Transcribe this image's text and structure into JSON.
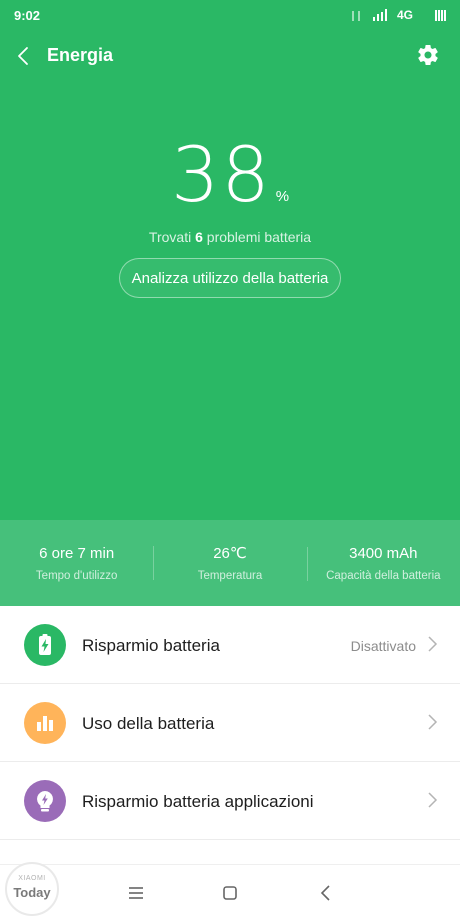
{
  "status": {
    "time": "9:02",
    "network": "4G"
  },
  "header": {
    "title": "Energia"
  },
  "battery": {
    "level": "38",
    "unit": "%"
  },
  "problems": {
    "prefix": "Trovati",
    "count": "6",
    "suffix": "problemi batteria"
  },
  "analyze_button": "Analizza utilizzo della batteria",
  "stats": [
    {
      "value": "6 ore 7 min",
      "label": "Tempo d'utilizzo"
    },
    {
      "value": "26℃",
      "label": "Temperatura"
    },
    {
      "value": "3400 mAh",
      "label": "Capacità della batteria"
    }
  ],
  "list": [
    {
      "label": "Risparmio batteria",
      "value": "Disattivato",
      "icon": "battery-saver-icon",
      "color": "#2ab865"
    },
    {
      "label": "Uso della batteria",
      "value": "",
      "icon": "bar-chart-icon",
      "color": "#ffb45a"
    },
    {
      "label": "Risparmio batteria applicazioni",
      "value": "",
      "icon": "app-saver-icon",
      "color": "#9a6cb8"
    }
  ],
  "watermark": {
    "top": "XIAOMI",
    "bottom": "Today"
  },
  "colors": {
    "hero": "#2ab865",
    "stats_band": "#46c07b"
  }
}
